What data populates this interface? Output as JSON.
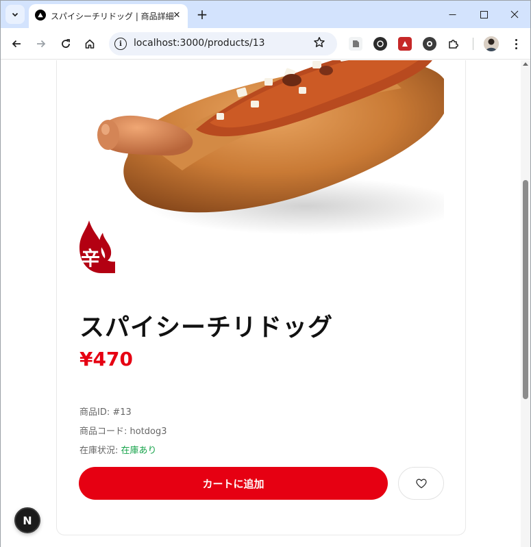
{
  "browser": {
    "tab_title": "スパイシーチリドッグ | 商品詳細",
    "url": "localhost:3000/products/13",
    "tab_close": "✕",
    "new_tab": "+",
    "minimize": "—",
    "maximize": "☐",
    "close": "✕"
  },
  "product": {
    "name": "スパイシーチリドッグ",
    "price": "¥470",
    "spicy_mark": "辛",
    "id_label": "商品ID: ",
    "id_value": "#13",
    "code_label": "商品コード: ",
    "code_value": "hotdog3",
    "stock_label": "在庫状況: ",
    "stock_value": "在庫あり",
    "add_to_cart": "カートに追加"
  },
  "dev": {
    "badge": "N"
  },
  "colors": {
    "accent": "#e60012",
    "stock": "#16a34a",
    "tabstrip": "#d3e3fd"
  }
}
